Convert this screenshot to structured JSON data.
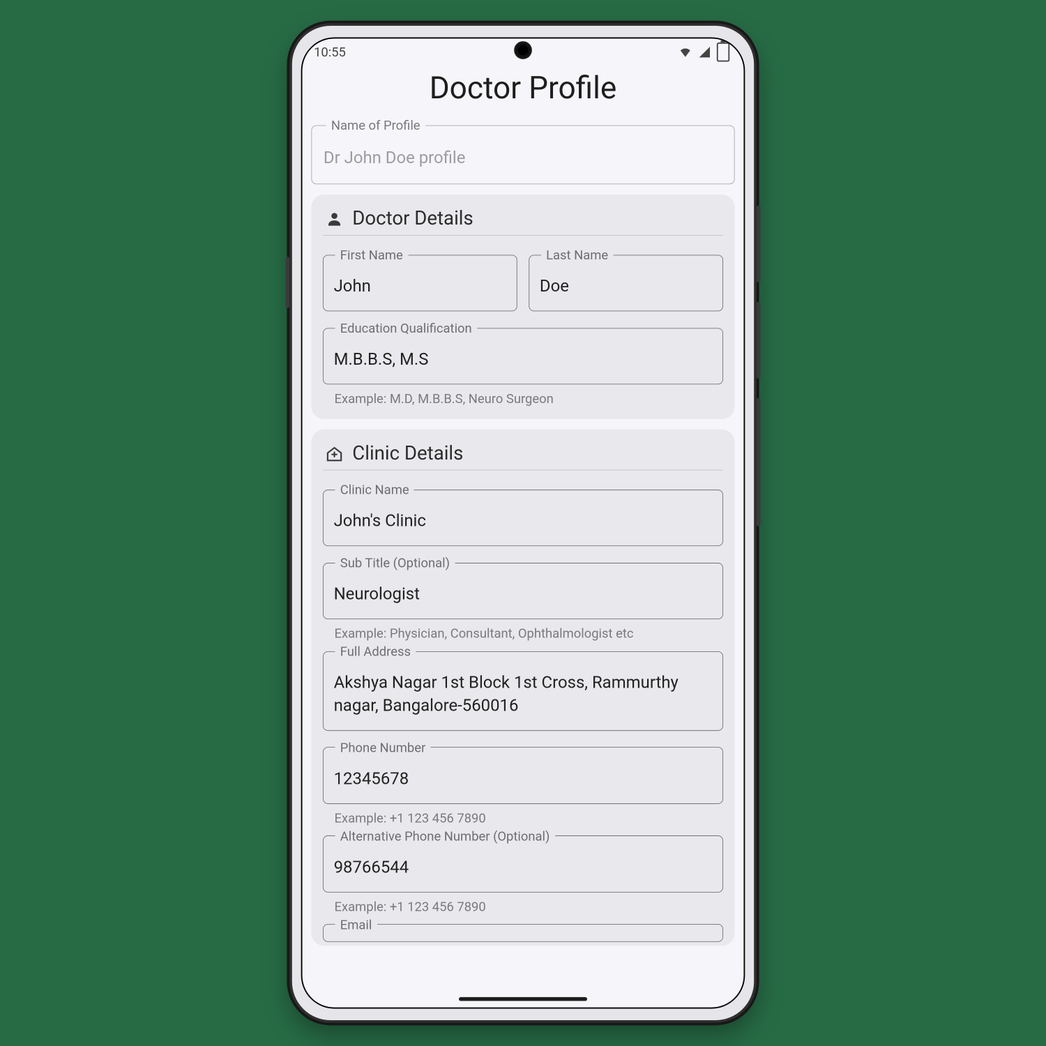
{
  "status": {
    "time": "10:55"
  },
  "page": {
    "title": "Doctor Profile"
  },
  "profile_name": {
    "label": "Name of Profile",
    "placeholder": "Dr John Doe profile"
  },
  "sections": {
    "doctor": {
      "title": "Doctor Details",
      "first_name": {
        "label": "First Name",
        "value": "John"
      },
      "last_name": {
        "label": "Last Name",
        "value": "Doe"
      },
      "qualification": {
        "label": "Education Qualification",
        "value": "M.B.B.S, M.S",
        "hint": "Example: M.D, M.B.B.S, Neuro Surgeon"
      }
    },
    "clinic": {
      "title": "Clinic Details",
      "clinic_name": {
        "label": "Clinic Name",
        "value": "John's Clinic"
      },
      "sub_title": {
        "label": "Sub Title (Optional)",
        "value": "Neurologist",
        "hint": "Example: Physician, Consultant, Ophthalmologist etc"
      },
      "address": {
        "label": "Full Address",
        "value": "Akshya Nagar 1st Block 1st Cross, Rammurthy nagar, Bangalore-560016"
      },
      "phone": {
        "label": "Phone Number",
        "value": "12345678",
        "hint": "Example: +1 123 456 7890"
      },
      "alt_phone": {
        "label": "Alternative Phone Number (Optional)",
        "value": "98766544",
        "hint": "Example: +1 123 456 7890"
      },
      "email": {
        "label": "Email"
      }
    }
  }
}
